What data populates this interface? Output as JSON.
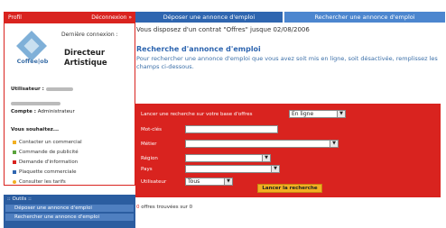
{
  "profile": {
    "header_left": "Profil",
    "header_right": "Déconnexion »",
    "logo_text": "Coffee|ob",
    "last_connection": "Dernière connexion :",
    "role_line1": "Directeur",
    "role_line2": "Artistique",
    "user_label": "Utilisateur :",
    "account_label": "Compte :",
    "account_value": "Administrateur",
    "wishes_title": "Vous souhaitez...",
    "menu": [
      {
        "label": "Contacter un commercial",
        "icon_color": "#f2b022"
      },
      {
        "label": "Commande de publicité",
        "icon_color": "#5aa33c"
      },
      {
        "label": "Demande d'information",
        "icon_color": "#d9231f"
      },
      {
        "label": "Plaquette commerciale",
        "icon_color": "#2f66b0"
      },
      {
        "label": "Consulter les tarifs",
        "icon_color": "#f2b022"
      }
    ]
  },
  "outils": {
    "title": ":: Outils ::",
    "items": [
      "Déposer une annonce d'emploi",
      "Rechercher une annonce d'emploi"
    ]
  },
  "tabs": [
    "Déposer une annonce d'emploi",
    "Rechercher une annonce d'emploi"
  ],
  "contract_text": "Vous disposez d'un contrat \"Offres\" jusque 02/08/2006",
  "search": {
    "title": "Recherche d'annonce d'emploi",
    "description": "Pour rechercher une annonce d'emploi que vous avez soit mis en ligne, soit désactivée, remplissez les champs ci-dessous.",
    "form": {
      "launch_label": "Lancer une recherche sur votre base d'offres",
      "launch_value": "En ligne",
      "keywords_label": "Mot-clés",
      "job_label": "Métier",
      "region_label": "Région",
      "country_label": "Pays",
      "user_label": "Utilisateur",
      "user_value": "Tous",
      "submit_label": "Lancer la recherche"
    }
  },
  "results_text": "offres trouvées sur 0",
  "colors": {
    "brand_red": "#d9231f",
    "brand_blue": "#2f66b0",
    "button_yellow": "#f2b022"
  }
}
